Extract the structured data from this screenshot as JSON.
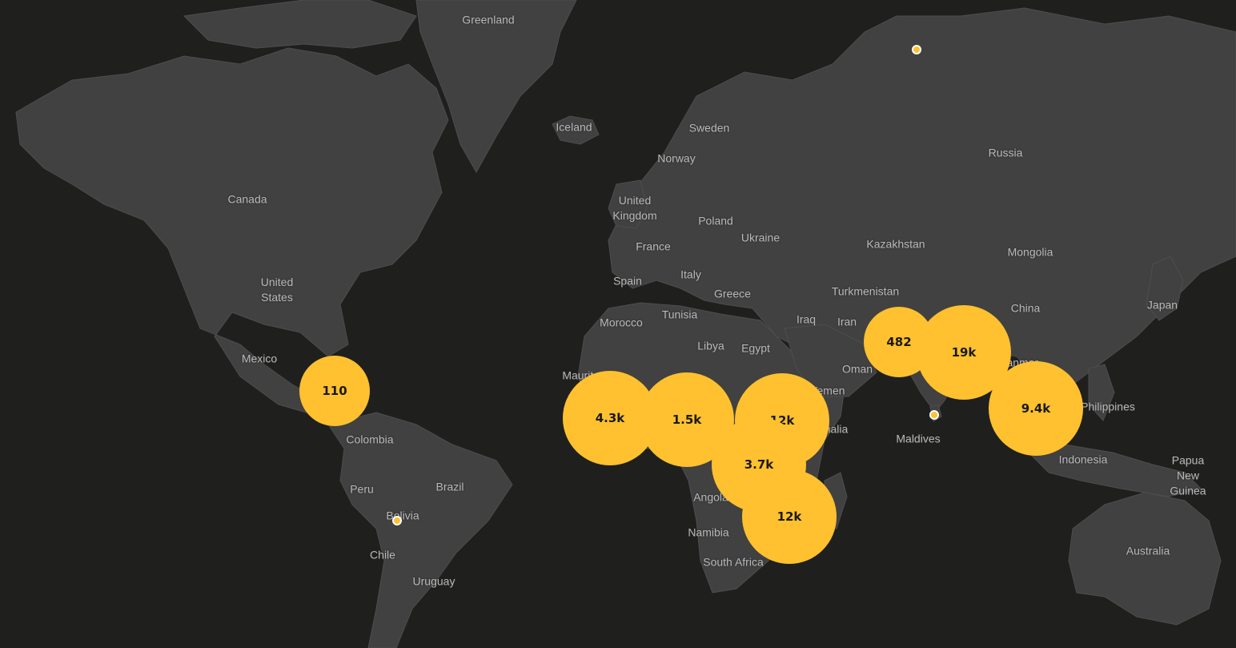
{
  "map": {
    "colors": {
      "background": "#1f201e",
      "land": "#414141",
      "border": "#4d4d4d",
      "label": "#b9b9b9",
      "marker": "#ffc12f",
      "marker_text": "#1a1a1a"
    },
    "labels": [
      {
        "id": "greenland",
        "text": "Greenland"
      },
      {
        "id": "iceland",
        "text": "Iceland"
      },
      {
        "id": "sweden",
        "text": "Sweden"
      },
      {
        "id": "norway",
        "text": "Norway"
      },
      {
        "id": "russia",
        "text": "Russia"
      },
      {
        "id": "canada",
        "text": "Canada"
      },
      {
        "id": "united-kingdom",
        "text": "United\nKingdom"
      },
      {
        "id": "poland",
        "text": "Poland"
      },
      {
        "id": "france",
        "text": "France"
      },
      {
        "id": "ukraine",
        "text": "Ukraine"
      },
      {
        "id": "kazakhstan",
        "text": "Kazakhstan"
      },
      {
        "id": "mongolia",
        "text": "Mongolia"
      },
      {
        "id": "spain",
        "text": "Spain"
      },
      {
        "id": "italy",
        "text": "Italy"
      },
      {
        "id": "united-states",
        "text": "United\nStates"
      },
      {
        "id": "turkmenistan",
        "text": "Turkmenistan"
      },
      {
        "id": "greece",
        "text": "Greece"
      },
      {
        "id": "china",
        "text": "China"
      },
      {
        "id": "japan",
        "text": "Japan"
      },
      {
        "id": "morocco",
        "text": "Morocco"
      },
      {
        "id": "tunisia",
        "text": "Tunisia"
      },
      {
        "id": "iraq",
        "text": "Iraq"
      },
      {
        "id": "iran",
        "text": "Iran"
      },
      {
        "id": "libya",
        "text": "Libya"
      },
      {
        "id": "egypt",
        "text": "Egypt"
      },
      {
        "id": "mexico",
        "text": "Mexico"
      },
      {
        "id": "oman",
        "text": "Oman"
      },
      {
        "id": "yemen",
        "text": "Yemen"
      },
      {
        "id": "philippines",
        "text": "Philippines"
      },
      {
        "id": "somalia",
        "text": "Somalia"
      },
      {
        "id": "colombia",
        "text": "Colombia"
      },
      {
        "id": "maldives",
        "text": "Maldives"
      },
      {
        "id": "indonesia",
        "text": "Indonesia"
      },
      {
        "id": "papua-new-guinea",
        "text": "Papua New\nGuinea"
      },
      {
        "id": "brazil",
        "text": "Brazil"
      },
      {
        "id": "peru",
        "text": "Peru"
      },
      {
        "id": "angola",
        "text": "Angola"
      },
      {
        "id": "bolivia",
        "text": "Bolivia"
      },
      {
        "id": "namibia",
        "text": "Namibia"
      },
      {
        "id": "australia",
        "text": "Australia"
      },
      {
        "id": "chile",
        "text": "Chile"
      },
      {
        "id": "south-africa",
        "text": "South Africa"
      },
      {
        "id": "uruguay",
        "text": "Uruguay"
      },
      {
        "id": "mauritania",
        "text": "Mauritania"
      },
      {
        "id": "myanmar",
        "text": "Myanmar"
      }
    ],
    "clusters": [
      {
        "id": "central-america",
        "label": "110"
      },
      {
        "id": "west-africa",
        "label": "4.3k"
      },
      {
        "id": "central-africa",
        "label": "1.5k"
      },
      {
        "id": "east-africa",
        "label": "12k"
      },
      {
        "id": "congo",
        "label": "3.7k"
      },
      {
        "id": "southern-africa",
        "label": "12k"
      },
      {
        "id": "south-asia",
        "label": "482"
      },
      {
        "id": "india",
        "label": "19k"
      },
      {
        "id": "southeast-asia",
        "label": "9.4k"
      }
    ],
    "points": [
      {
        "id": "russia-north"
      },
      {
        "id": "sri-lanka"
      },
      {
        "id": "bolivia"
      }
    ]
  }
}
